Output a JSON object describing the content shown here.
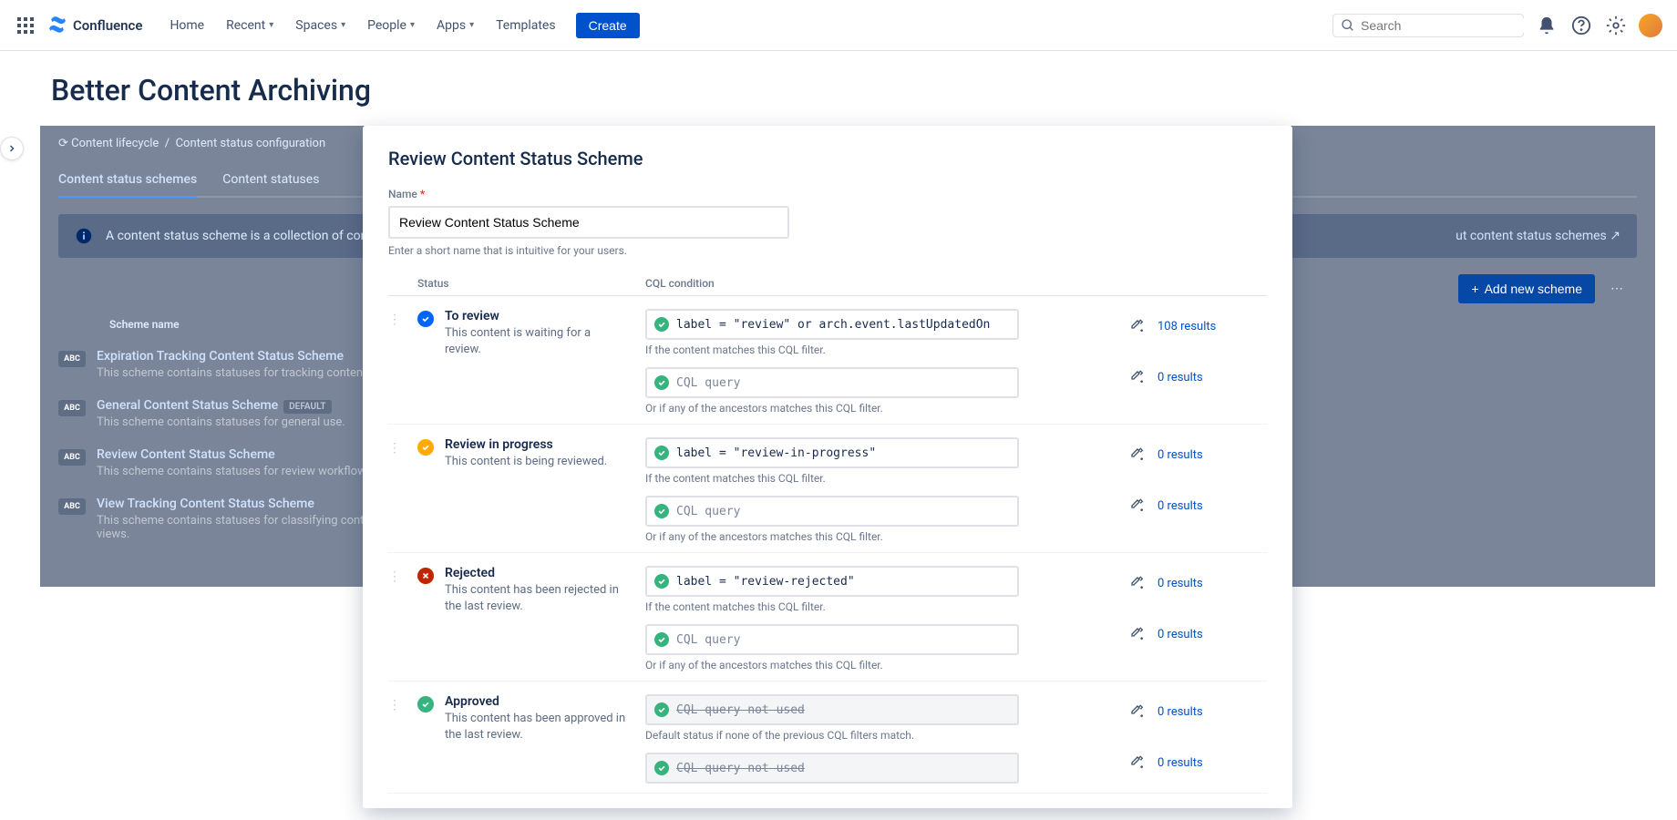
{
  "topnav": {
    "product": "Confluence",
    "links": {
      "home": "Home",
      "recent": "Recent",
      "spaces": "Spaces",
      "people": "People",
      "apps": "Apps",
      "templates": "Templates"
    },
    "create": "Create",
    "search_placeholder": "Search"
  },
  "page": {
    "title": "Better Content Archiving"
  },
  "breadcrumbs": {
    "item1": "Content lifecycle",
    "item2": "Content status configuration"
  },
  "tabs": {
    "schemes": "Content status schemes",
    "statuses": "Content statuses"
  },
  "info_banner": {
    "text": "A content status scheme is a collection of content stat",
    "learn_suffix": "ut content status schemes",
    "learn_icon": "↗"
  },
  "actions": {
    "add_new_scheme": "Add new scheme"
  },
  "scheme_list": {
    "col_header": "Scheme name",
    "badge": "ABC",
    "default_tag": "DEFAULT",
    "items": [
      {
        "name": "Expiration Tracking Content Status Scheme",
        "desc": "This scheme contains statuses for tracking contents t\nperiodically.",
        "default": false
      },
      {
        "name": "General Content Status Scheme",
        "desc": "This scheme contains statuses for general use.",
        "default": true
      },
      {
        "name": "Review Content Status Scheme",
        "desc": "This scheme contains statuses for review workflows (a\nprocesses).",
        "default": false
      },
      {
        "name": "View Tracking Content Status Scheme",
        "desc": "This scheme contains statuses for classifying content\npassed since their last views.",
        "default": false
      }
    ]
  },
  "modal": {
    "title": "Review Content Status Scheme",
    "name_label": "Name",
    "name_value": "Review Content Status Scheme",
    "name_help": "Enter a short name that is intuitive for your users.",
    "headers": {
      "status": "Status",
      "cql": "CQL condition"
    },
    "help_content": "If the content matches this CQL filter.",
    "help_ancestor": "Or if any of the ancestors matches this CQL filter.",
    "help_default": "Default status if none of the previous CQL filters match.",
    "placeholder_cql": "CQL query",
    "placeholder_notused": "CQL query not used",
    "statuses": [
      {
        "color": "blue",
        "name": "To review",
        "desc": "This content is waiting for a review.",
        "content_cql": "label = \"review\" or arch.event.lastUpdatedOn",
        "content_results": "108 results",
        "ancestor_cql": "",
        "ancestor_results": "0 results"
      },
      {
        "color": "yellow",
        "name": "Review in progress",
        "desc": "This content is being reviewed.",
        "content_cql": "label = \"review-in-progress\"",
        "content_results": "0 results",
        "ancestor_cql": "",
        "ancestor_results": "0 results"
      },
      {
        "color": "red",
        "name": "Rejected",
        "desc": "This content has been rejected in the last review.",
        "content_cql": "label = \"review-rejected\"",
        "content_results": "0 results",
        "ancestor_cql": "",
        "ancestor_results": "0 results"
      },
      {
        "color": "green",
        "name": "Approved",
        "desc": "This content has been approved in the last review.",
        "content_cql": "",
        "content_results": "0 results",
        "ancestor_cql": "",
        "ancestor_results": "0 results",
        "is_default": true
      }
    ]
  }
}
